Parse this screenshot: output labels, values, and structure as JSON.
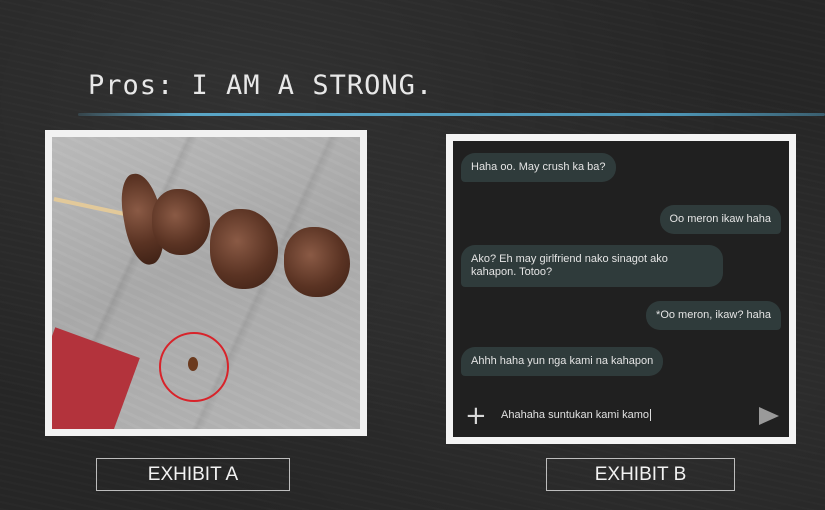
{
  "slide": {
    "title": "Pros: I AM A STRONG.",
    "accent_color": "#5aa6c7"
  },
  "exhibit_a": {
    "label": "EXHIBIT A",
    "image_description_icon": "skewered-meat-photo"
  },
  "exhibit_b": {
    "label": "EXHIBIT B",
    "messages": [
      {
        "text": "Haha oo. May crush ka ba?",
        "side": "incoming"
      },
      {
        "text": "Oo meron ikaw haha",
        "side": "outgoing"
      },
      {
        "text": "Ako? Eh may girlfriend nako sinagot ako kahapon. Totoo?",
        "side": "incoming"
      },
      {
        "text": "*Oo meron, ikaw? haha",
        "side": "outgoing"
      },
      {
        "text": "Ahhh haha yun nga kami na kahapon",
        "side": "incoming"
      }
    ],
    "compose_text": "Ahahaha suntukan kami kamo"
  }
}
